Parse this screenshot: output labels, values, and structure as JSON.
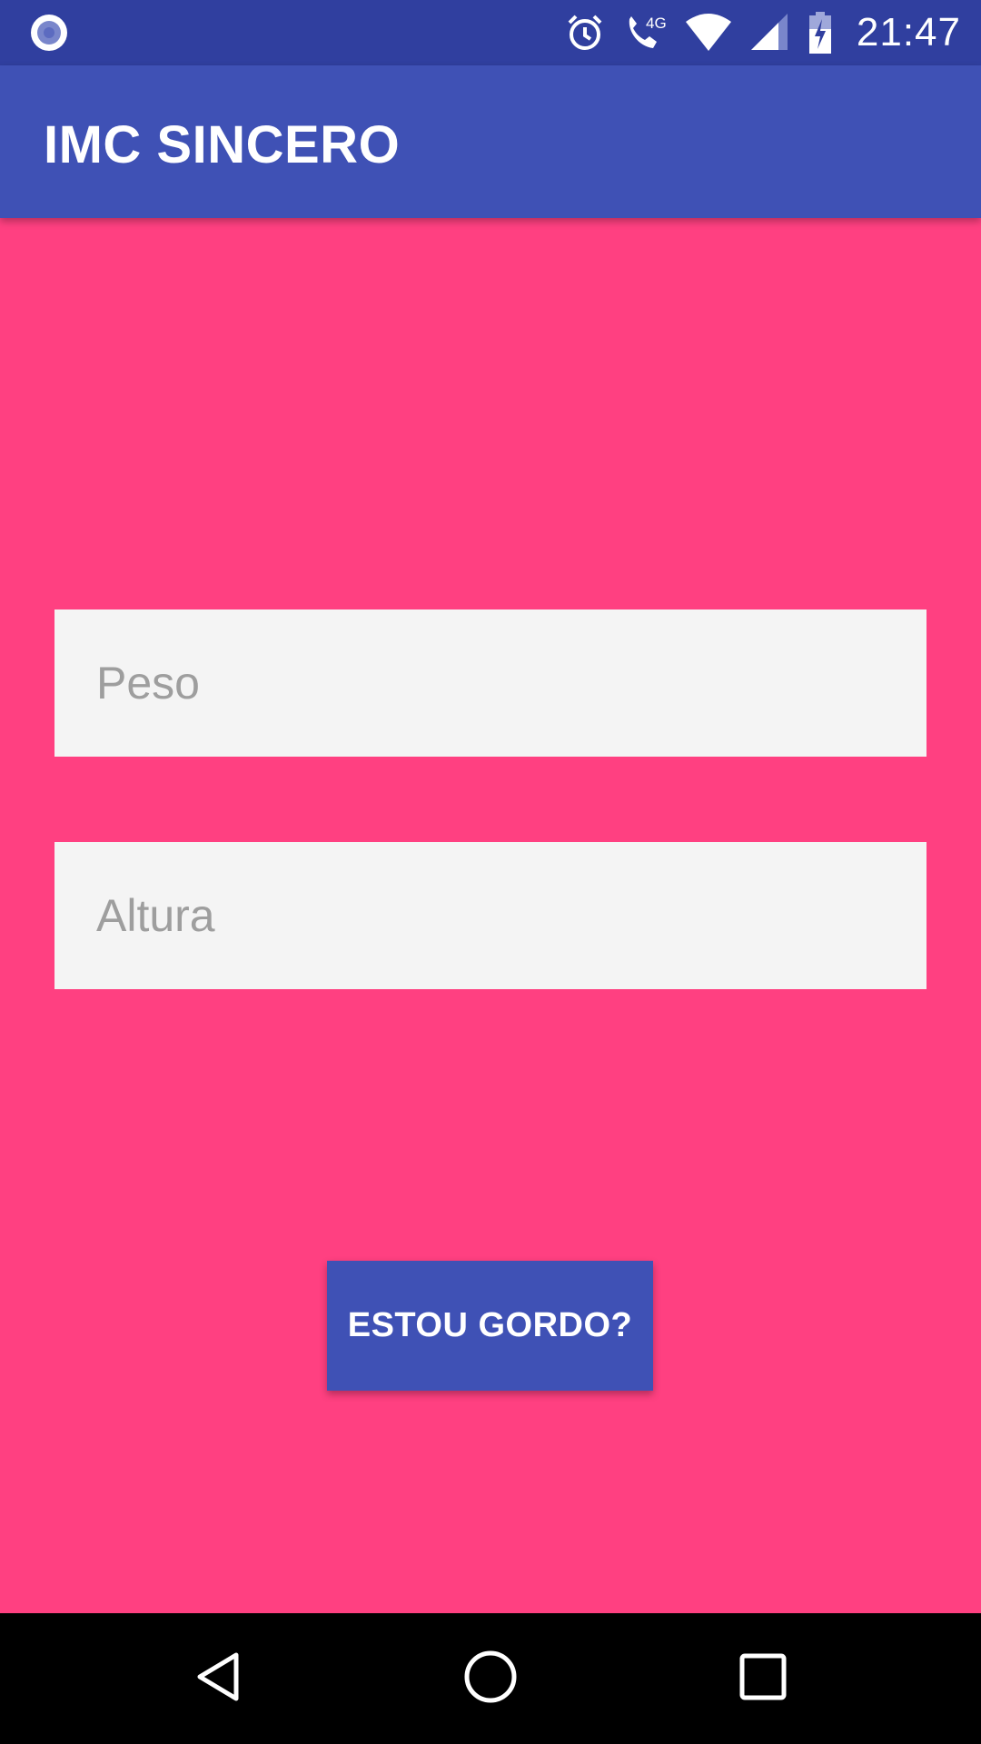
{
  "status_bar": {
    "time": "21:47",
    "network_label": "4G",
    "icons": [
      "app-notification-icon",
      "alarm-icon",
      "wifi-calling-icon",
      "wifi-icon",
      "cell-signal-icon",
      "battery-charging-icon"
    ]
  },
  "app_bar": {
    "title": "IMC SINCERO"
  },
  "form": {
    "peso_placeholder": "Peso",
    "altura_placeholder": "Altura",
    "submit_label": "ESTOU GORDO?"
  },
  "nav_bar": {
    "icons": [
      "back-icon",
      "home-icon",
      "recents-icon"
    ]
  },
  "colors": {
    "status_bar": "#303f9f",
    "app_bar": "#3f51b5",
    "background": "#ff4081",
    "field_background": "#f4f4f4",
    "button": "#3f51b5"
  }
}
